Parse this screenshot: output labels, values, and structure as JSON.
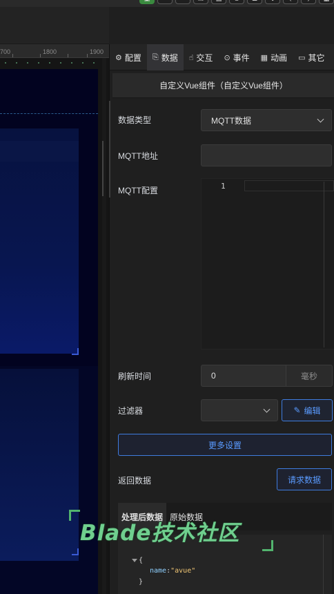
{
  "toolbar": {
    "buttons": [
      "preview-icon",
      "undo-icon",
      "redo-icon",
      "copy-icon",
      "paste-icon",
      "align-icon",
      "distribute-icon",
      "flip-icon",
      "back-icon",
      "forward-icon",
      "grid-icon"
    ]
  },
  "ruler": {
    "ticks": [
      "700",
      "1800",
      "1900"
    ]
  },
  "tabs": [
    {
      "label": "配置",
      "icon": "gear-icon"
    },
    {
      "label": "数据",
      "icon": "data-icon"
    },
    {
      "label": "交互",
      "icon": "hand-icon"
    },
    {
      "label": "事件",
      "icon": "mouse-icon"
    },
    {
      "label": "动画",
      "icon": "film-icon"
    },
    {
      "label": "其它",
      "icon": "folder-icon"
    }
  ],
  "component_title": "自定义Vue组件（自定义Vue组件）",
  "form": {
    "data_type_label": "数据类型",
    "data_type_value": "MQTT数据",
    "mqtt_address_label": "MQTT地址",
    "mqtt_address_value": "",
    "mqtt_config_label": "MQTT配置",
    "editor_line": "1",
    "refresh_label": "刷新时间",
    "refresh_value": "0",
    "refresh_unit": "毫秒",
    "filter_label": "过滤器",
    "filter_value": "",
    "edit_button": "编辑",
    "more_settings_button": "更多设置",
    "return_data_label": "返回数据",
    "request_data_button": "请求数据"
  },
  "result_tabs": [
    "处理后数据",
    "原始数据"
  ],
  "json_preview": {
    "open": "{",
    "key": "name",
    "value": "\"avue\"",
    "close": "}"
  },
  "watermark": "Blade技术社区",
  "colors": {
    "accent": "#3f7de0",
    "accent_text": "#5a9bff",
    "panel_bg": "#1f1f1f",
    "canvas_bg": "#020320",
    "watermark": "#6fcf8e"
  }
}
